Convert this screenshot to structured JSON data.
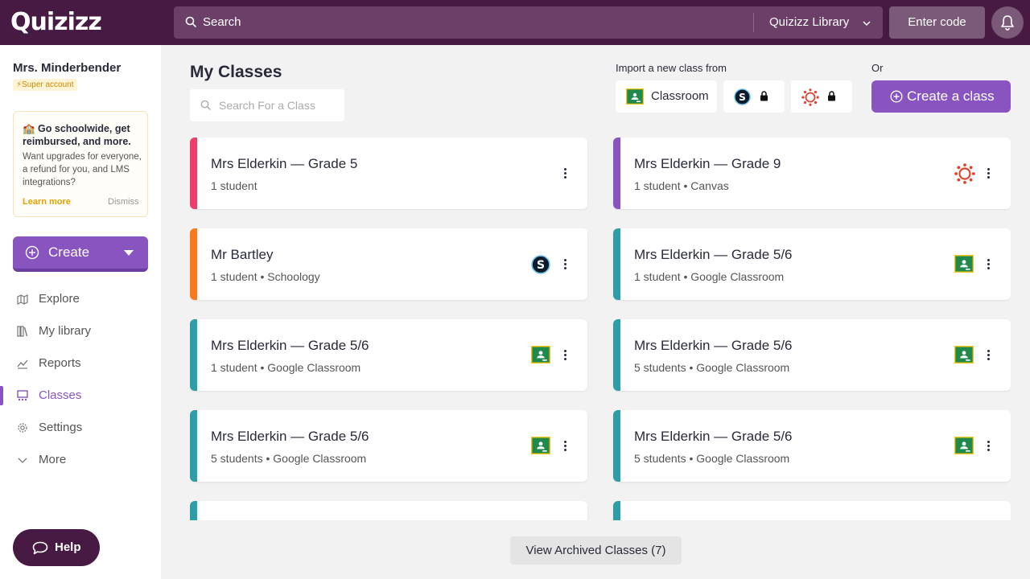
{
  "header": {
    "logo": "Quizizz",
    "search_label": "Search",
    "library_label": "Quizizz Library",
    "enter_code_label": "Enter code"
  },
  "sidebar": {
    "user_name": "Mrs. Minderbender",
    "account_badge": "⚡Super account",
    "promo": {
      "title": "🏫 Go schoolwide, get reimbursed, and more.",
      "body": "Want upgrades for everyone, a refund for you, and LMS integrations?",
      "learn_more": "Learn more",
      "dismiss": "Dismiss"
    },
    "create_label": "Create",
    "nav": [
      {
        "label": "Explore",
        "icon": "explore-icon",
        "active": false
      },
      {
        "label": "My library",
        "icon": "library-icon",
        "active": false
      },
      {
        "label": "Reports",
        "icon": "reports-icon",
        "active": false
      },
      {
        "label": "Classes",
        "icon": "classes-icon",
        "active": true
      },
      {
        "label": "Settings",
        "icon": "settings-icon",
        "active": false
      },
      {
        "label": "More",
        "icon": "chevron-down-icon",
        "active": false
      }
    ],
    "help_label": "Help"
  },
  "main": {
    "title": "My Classes",
    "search_placeholder": "Search For a Class",
    "import_label": "Import a new class from",
    "or_label": "Or",
    "import_classroom_label": "Classroom",
    "create_class_label": "Create a class",
    "archived_label": "View Archived Classes (7)",
    "classes": [
      {
        "title": "Mrs Elderkin — Grade 5",
        "subtitle": "1 student",
        "color": "#ec3e6b",
        "brand": "none"
      },
      {
        "title": "Mrs Elderkin — Grade 9",
        "subtitle": "1 student • Canvas",
        "color": "#8854c0",
        "brand": "canvas"
      },
      {
        "title": "Mr Bartley",
        "subtitle": "1 student • Schoology",
        "color": "#f77a1d",
        "brand": "schoology"
      },
      {
        "title": "Mrs Elderkin — Grade 5/6",
        "subtitle": "1 student • Google Classroom",
        "color": "#2d9da6",
        "brand": "google-classroom"
      },
      {
        "title": "Mrs Elderkin — Grade 5/6",
        "subtitle": "1 student • Google Classroom",
        "color": "#2d9da6",
        "brand": "google-classroom"
      },
      {
        "title": "Mrs Elderkin — Grade 5/6",
        "subtitle": "5 students • Google Classroom",
        "color": "#2d9da6",
        "brand": "google-classroom"
      },
      {
        "title": "Mrs Elderkin — Grade 5/6",
        "subtitle": "5 students • Google Classroom",
        "color": "#2d9da6",
        "brand": "google-classroom"
      },
      {
        "title": "Mrs Elderkin — Grade 5/6",
        "subtitle": "5 students • Google Classroom",
        "color": "#2d9da6",
        "brand": "google-classroom"
      },
      {
        "title": "",
        "subtitle": "",
        "color": "#2d9da6",
        "brand": "none"
      },
      {
        "title": "",
        "subtitle": "",
        "color": "#2d9da6",
        "brand": "none"
      }
    ]
  },
  "colors": {
    "header_bg": "#461a42",
    "accent": "#8854c0",
    "page_bg": "#f2f2f2"
  }
}
